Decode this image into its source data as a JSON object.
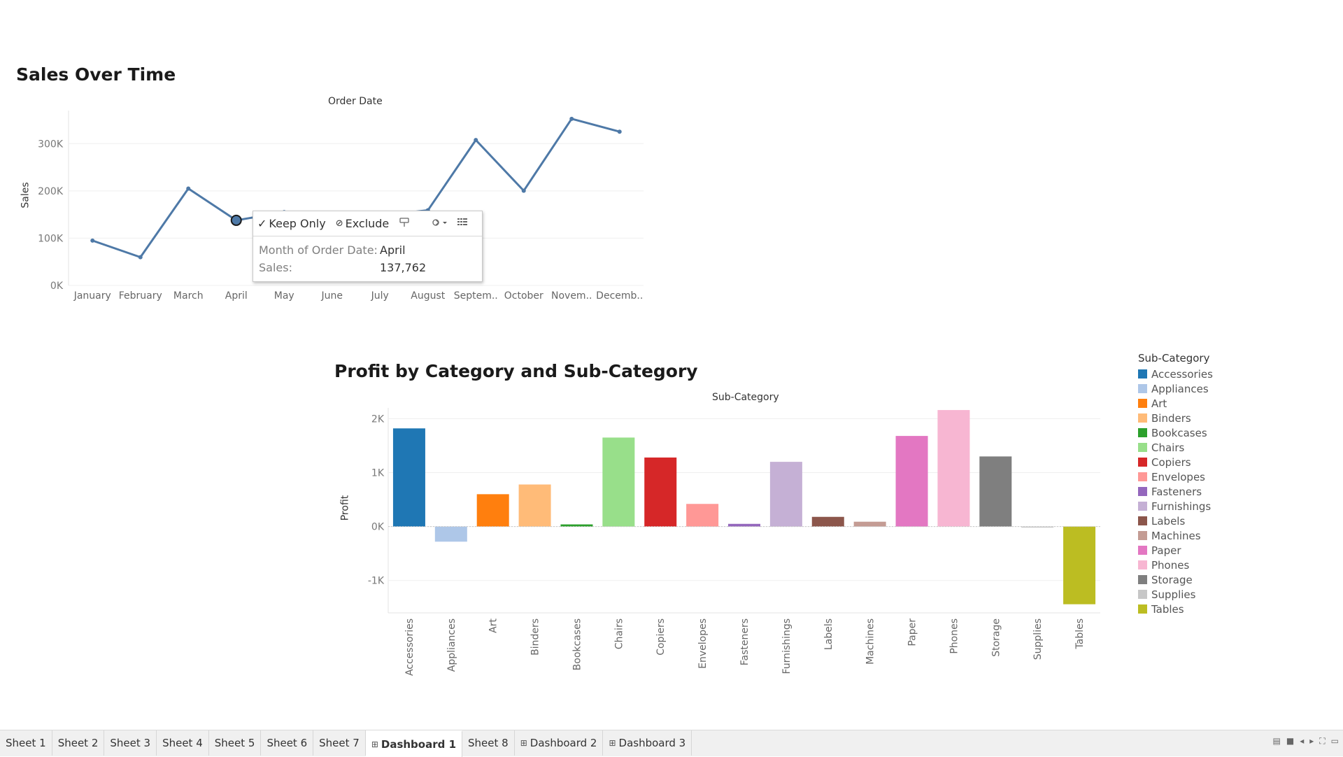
{
  "sales_chart": {
    "title": "Sales Over Time",
    "column_header": "Order Date",
    "ylabel": "Sales",
    "chart_data": {
      "type": "line",
      "categories": [
        "January",
        "February",
        "March",
        "April",
        "May",
        "June",
        "July",
        "August",
        "Septem..",
        "October",
        "Novem..",
        "Decemb.."
      ],
      "values": [
        94925,
        59751,
        205005,
        137762,
        155028,
        152718,
        147238,
        159044,
        307650,
        200322,
        352461,
        325293
      ],
      "ylim": [
        0,
        370000
      ],
      "yticks": [
        0,
        100000,
        200000,
        300000
      ],
      "ytick_labels": [
        "0K",
        "100K",
        "200K",
        "300K"
      ],
      "line_color": "#4e79a7",
      "highlighted_index": 3
    }
  },
  "tooltip": {
    "keep_only": "Keep Only",
    "exclude": "Exclude",
    "field1_label": "Month of Order Date:",
    "field1_value": "April",
    "field2_label": "Sales:",
    "field2_value": "137,762",
    "icons": [
      "check-icon",
      "exclude-icon",
      "pin-icon",
      "group-icon",
      "view-data-icon"
    ]
  },
  "profit_chart": {
    "title": "Profit by Category and Sub-Category",
    "column_header": "Sub-Category",
    "ylabel": "Profit",
    "chart_data": {
      "type": "bar",
      "categories": [
        "Accessories",
        "Appliances",
        "Art",
        "Binders",
        "Bookcases",
        "Chairs",
        "Copiers",
        "Envelopes",
        "Fasteners",
        "Furnishings",
        "Labels",
        "Machines",
        "Paper",
        "Phones",
        "Storage",
        "Supplies",
        "Tables"
      ],
      "values": [
        1820,
        -280,
        600,
        780,
        40,
        1650,
        1280,
        420,
        50,
        1200,
        180,
        90,
        1680,
        2160,
        1300,
        -10,
        -1440
      ],
      "colors": [
        "#1f77b4",
        "#aec7e8",
        "#ff7f0e",
        "#ffbb78",
        "#2ca02c",
        "#98df8a",
        "#d62728",
        "#ff9896",
        "#9467bd",
        "#c5b0d5",
        "#8c564b",
        "#c49c94",
        "#e377c2",
        "#f7b6d2",
        "#7f7f7f",
        "#c7c7c7",
        "#bcbd22"
      ],
      "ylim": [
        -1600,
        2200
      ],
      "yticks": [
        -1000,
        0,
        1000,
        2000
      ],
      "ytick_labels": [
        "-1K",
        "0K",
        "1K",
        "2K"
      ]
    }
  },
  "legend": {
    "title": "Sub-Category"
  },
  "tabs": [
    {
      "label": "Sheet 1",
      "icon": "",
      "active": false
    },
    {
      "label": "Sheet 2",
      "icon": "",
      "active": false
    },
    {
      "label": "Sheet 3",
      "icon": "",
      "active": false
    },
    {
      "label": "Sheet 4",
      "icon": "",
      "active": false
    },
    {
      "label": "Sheet 5",
      "icon": "",
      "active": false
    },
    {
      "label": "Sheet 6",
      "icon": "",
      "active": false
    },
    {
      "label": "Sheet 7",
      "icon": "",
      "active": false
    },
    {
      "label": "Dashboard 1",
      "icon": "dashboard-icon",
      "active": true
    },
    {
      "label": "Sheet 8",
      "icon": "",
      "active": false
    },
    {
      "label": "Dashboard 2",
      "icon": "dashboard-icon",
      "active": false
    },
    {
      "label": "Dashboard 3",
      "icon": "dashboard-icon",
      "active": false
    }
  ],
  "tab_controls": [
    "show-filmstrip-icon",
    "show-tabs-icon",
    "prev-sheet-icon",
    "next-sheet-icon",
    "fullscreen-icon",
    "presentation-icon"
  ]
}
